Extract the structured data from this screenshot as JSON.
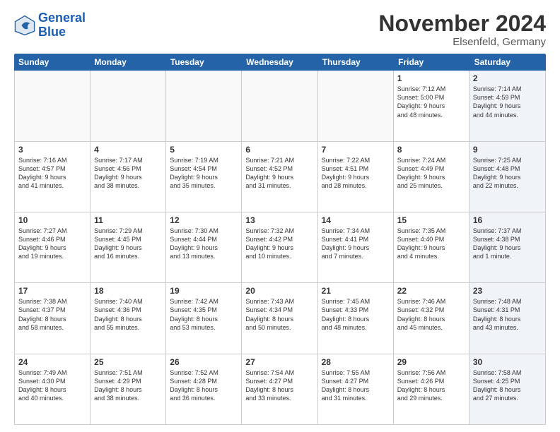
{
  "logo": {
    "line1": "General",
    "line2": "Blue"
  },
  "title": "November 2024",
  "subtitle": "Elsenfeld, Germany",
  "days": [
    "Sunday",
    "Monday",
    "Tuesday",
    "Wednesday",
    "Thursday",
    "Friday",
    "Saturday"
  ],
  "weeks": [
    [
      {
        "day": "",
        "info": ""
      },
      {
        "day": "",
        "info": ""
      },
      {
        "day": "",
        "info": ""
      },
      {
        "day": "",
        "info": ""
      },
      {
        "day": "",
        "info": ""
      },
      {
        "day": "1",
        "info": "Sunrise: 7:12 AM\nSunset: 5:00 PM\nDaylight: 9 hours\nand 48 minutes."
      },
      {
        "day": "2",
        "info": "Sunrise: 7:14 AM\nSunset: 4:59 PM\nDaylight: 9 hours\nand 44 minutes."
      }
    ],
    [
      {
        "day": "3",
        "info": "Sunrise: 7:16 AM\nSunset: 4:57 PM\nDaylight: 9 hours\nand 41 minutes."
      },
      {
        "day": "4",
        "info": "Sunrise: 7:17 AM\nSunset: 4:56 PM\nDaylight: 9 hours\nand 38 minutes."
      },
      {
        "day": "5",
        "info": "Sunrise: 7:19 AM\nSunset: 4:54 PM\nDaylight: 9 hours\nand 35 minutes."
      },
      {
        "day": "6",
        "info": "Sunrise: 7:21 AM\nSunset: 4:52 PM\nDaylight: 9 hours\nand 31 minutes."
      },
      {
        "day": "7",
        "info": "Sunrise: 7:22 AM\nSunset: 4:51 PM\nDaylight: 9 hours\nand 28 minutes."
      },
      {
        "day": "8",
        "info": "Sunrise: 7:24 AM\nSunset: 4:49 PM\nDaylight: 9 hours\nand 25 minutes."
      },
      {
        "day": "9",
        "info": "Sunrise: 7:25 AM\nSunset: 4:48 PM\nDaylight: 9 hours\nand 22 minutes."
      }
    ],
    [
      {
        "day": "10",
        "info": "Sunrise: 7:27 AM\nSunset: 4:46 PM\nDaylight: 9 hours\nand 19 minutes."
      },
      {
        "day": "11",
        "info": "Sunrise: 7:29 AM\nSunset: 4:45 PM\nDaylight: 9 hours\nand 16 minutes."
      },
      {
        "day": "12",
        "info": "Sunrise: 7:30 AM\nSunset: 4:44 PM\nDaylight: 9 hours\nand 13 minutes."
      },
      {
        "day": "13",
        "info": "Sunrise: 7:32 AM\nSunset: 4:42 PM\nDaylight: 9 hours\nand 10 minutes."
      },
      {
        "day": "14",
        "info": "Sunrise: 7:34 AM\nSunset: 4:41 PM\nDaylight: 9 hours\nand 7 minutes."
      },
      {
        "day": "15",
        "info": "Sunrise: 7:35 AM\nSunset: 4:40 PM\nDaylight: 9 hours\nand 4 minutes."
      },
      {
        "day": "16",
        "info": "Sunrise: 7:37 AM\nSunset: 4:38 PM\nDaylight: 9 hours\nand 1 minute."
      }
    ],
    [
      {
        "day": "17",
        "info": "Sunrise: 7:38 AM\nSunset: 4:37 PM\nDaylight: 8 hours\nand 58 minutes."
      },
      {
        "day": "18",
        "info": "Sunrise: 7:40 AM\nSunset: 4:36 PM\nDaylight: 8 hours\nand 55 minutes."
      },
      {
        "day": "19",
        "info": "Sunrise: 7:42 AM\nSunset: 4:35 PM\nDaylight: 8 hours\nand 53 minutes."
      },
      {
        "day": "20",
        "info": "Sunrise: 7:43 AM\nSunset: 4:34 PM\nDaylight: 8 hours\nand 50 minutes."
      },
      {
        "day": "21",
        "info": "Sunrise: 7:45 AM\nSunset: 4:33 PM\nDaylight: 8 hours\nand 48 minutes."
      },
      {
        "day": "22",
        "info": "Sunrise: 7:46 AM\nSunset: 4:32 PM\nDaylight: 8 hours\nand 45 minutes."
      },
      {
        "day": "23",
        "info": "Sunrise: 7:48 AM\nSunset: 4:31 PM\nDaylight: 8 hours\nand 43 minutes."
      }
    ],
    [
      {
        "day": "24",
        "info": "Sunrise: 7:49 AM\nSunset: 4:30 PM\nDaylight: 8 hours\nand 40 minutes."
      },
      {
        "day": "25",
        "info": "Sunrise: 7:51 AM\nSunset: 4:29 PM\nDaylight: 8 hours\nand 38 minutes."
      },
      {
        "day": "26",
        "info": "Sunrise: 7:52 AM\nSunset: 4:28 PM\nDaylight: 8 hours\nand 36 minutes."
      },
      {
        "day": "27",
        "info": "Sunrise: 7:54 AM\nSunset: 4:27 PM\nDaylight: 8 hours\nand 33 minutes."
      },
      {
        "day": "28",
        "info": "Sunrise: 7:55 AM\nSunset: 4:27 PM\nDaylight: 8 hours\nand 31 minutes."
      },
      {
        "day": "29",
        "info": "Sunrise: 7:56 AM\nSunset: 4:26 PM\nDaylight: 8 hours\nand 29 minutes."
      },
      {
        "day": "30",
        "info": "Sunrise: 7:58 AM\nSunset: 4:25 PM\nDaylight: 8 hours\nand 27 minutes."
      }
    ]
  ]
}
